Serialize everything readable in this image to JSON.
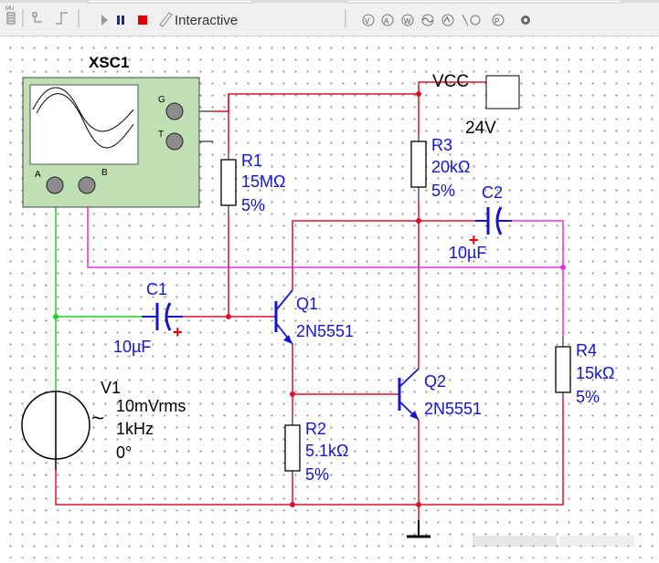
{
  "toolbar": {
    "mode_label": "Interactive",
    "small_tag": "MU"
  },
  "colors": {
    "wire_red": "#e0102a",
    "wire_green": "#22cc22",
    "wire_magenta": "#e030e0",
    "label_blue": "#1414d2",
    "scope_green": "#bfe0b4",
    "stop_red": "#e00000",
    "pause_blue": "#1a2a8a"
  },
  "circuit": {
    "oscilloscope": {
      "name": "XSC1",
      "ch_a": "A",
      "ch_b": "B",
      "ground": "G",
      "trigger": "T"
    },
    "vcc": {
      "label": "VCC",
      "value": "24V"
    },
    "r1": {
      "name": "R1",
      "value": "15MΩ",
      "tol": "5%"
    },
    "r2": {
      "name": "R2",
      "value": "5.1kΩ",
      "tol": "5%"
    },
    "r3": {
      "name": "R3",
      "value": "20kΩ",
      "tol": "5%"
    },
    "r4": {
      "name": "R4",
      "value": "15kΩ",
      "tol": "5%"
    },
    "c1": {
      "name": "C1",
      "value": "10µF",
      "polarity": "+"
    },
    "c2": {
      "name": "C2",
      "value": "10µF",
      "polarity": "+"
    },
    "q1": {
      "name": "Q1",
      "model": "2N5551"
    },
    "q2": {
      "name": "Q2",
      "model": "2N5551"
    },
    "v1": {
      "name": "V1",
      "amplitude": "10mVrms",
      "frequency": "1kHz",
      "phase": "0°",
      "symbol": "~"
    }
  }
}
